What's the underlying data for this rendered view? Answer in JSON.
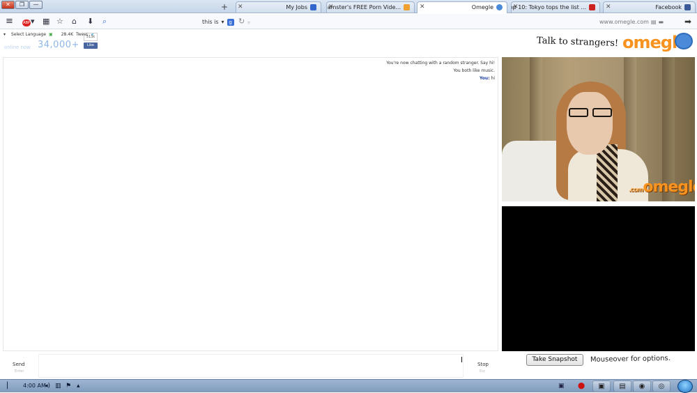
{
  "browser": {
    "window_buttons": [
      "✕",
      "❐",
      "—"
    ],
    "tabs": [
      {
        "label": "Facebook",
        "favicon_color": "#3b5998",
        "active": false
      },
      {
        "label": "Top 10: Tokyo tops the list ...",
        "favicon_color": "#cc2222",
        "active": false
      },
      {
        "label": "Omegle",
        "favicon_color": "#4a8ad8",
        "active": true
      },
      {
        "label": "xHamster's FREE Porn Vide...",
        "favicon_color": "#f0a030",
        "active": false
      },
      {
        "label": "My Jobs",
        "favicon_color": "#3366cc",
        "active": false
      }
    ],
    "new_tab": "+",
    "url": "www.omegle.com",
    "search_text": "this is",
    "icons": [
      "back-icon",
      "site-icon",
      "page-icon",
      "dropdown-icon",
      "refresh-icon",
      "search-icon",
      "download-icon",
      "home-icon",
      "bookmark-star-icon",
      "clipboard-icon",
      "addon-icon",
      "menu-icon"
    ]
  },
  "header": {
    "logo_text": "omegle",
    "tagline": "Talk to strangers!",
    "social": {
      "like_count": "513k",
      "like_label": "Like",
      "tweet_label": "Tweet",
      "tweet_count": "28.4K",
      "language_label": "Select Language"
    },
    "online_count": "34,000+",
    "online_label": "online now"
  },
  "chat": {
    "lines": [
      {
        "text": "You're now chatting with a random stranger. Say hi!"
      },
      {
        "text": "You both like music."
      },
      {
        "speaker": "You:",
        "text": "hi"
      }
    ]
  },
  "video": {
    "watermark": "omegle",
    "watermark_suffix": ".com"
  },
  "controls": {
    "mouseover_text": "Mouseover for options.",
    "snapshot_label": "Take Snapshot",
    "stop_label": "Stop",
    "stop_hint": "Esc",
    "send_label": "Send",
    "send_hint": "Enter"
  },
  "taskbar": {
    "clock": "4:00 AM"
  }
}
